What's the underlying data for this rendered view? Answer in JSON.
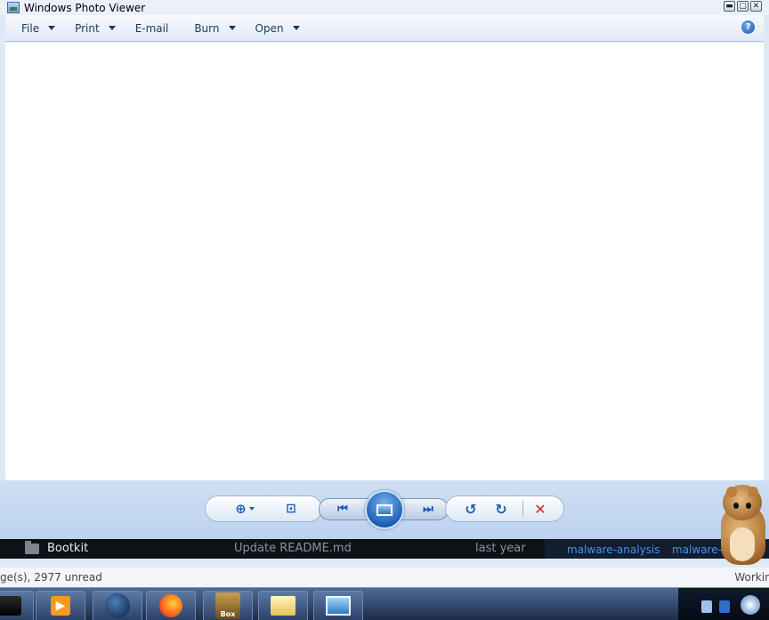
{
  "window": {
    "title": "Windows Photo Viewer",
    "controls": {
      "minimize": "▬",
      "maximize": "▢",
      "close": "✕"
    }
  },
  "menu": {
    "file": "File",
    "print": "Print",
    "email": "E-mail",
    "burn": "Burn",
    "open": "Open",
    "help_glyph": "?"
  },
  "controls": {
    "zoom_glyph": "⊕",
    "fit_glyph": "⊡",
    "prev_glyph": "⏮",
    "next_glyph": "⏭",
    "rotate_ccw_glyph": "↺",
    "rotate_cw_glyph": "↻",
    "delete_glyph": "✕"
  },
  "repo_row": {
    "name": "Bootkit",
    "commit_message": "Update README.md",
    "commit_age": "last year",
    "topics": [
      "malware-analysis",
      "malware-r"
    ]
  },
  "status": {
    "unread": "ge(s), 2977 unread",
    "working": "Workir"
  },
  "taskbar": {
    "items": [
      "printer-icon",
      "media-player-icon",
      "globe-icon",
      "firefox-icon",
      "sandboxie-icon",
      "folder-icon",
      "photo-viewer-icon"
    ],
    "sandbox_label": "Box",
    "media_glyph": "▶"
  },
  "colors": {
    "accent": "#1f5cb8",
    "delete": "#d0282c",
    "topic_link": "#4493f8"
  }
}
